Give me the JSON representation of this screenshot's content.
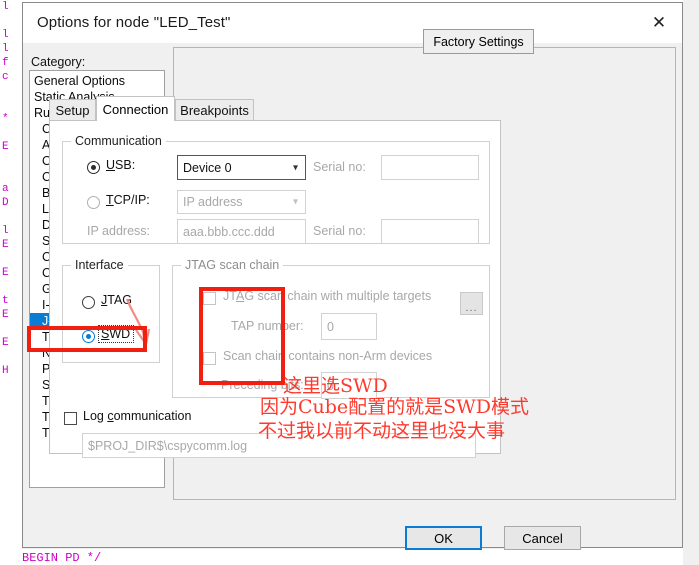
{
  "background": {
    "code_fragments": "l\n \nl\nl\nf\nc\n \n \n*\n \nE\n \n \na\nD\n \nl\nE\n \nE\n \nt\nE\n \nE\n \nH",
    "bottom_code": "BEGIN PD */"
  },
  "dialog": {
    "title": "Options for node \"LED_Test\"",
    "close_icon": "close-icon"
  },
  "category": {
    "label": "Category:",
    "items": [
      {
        "label": "General Options",
        "indent": false,
        "selected": false
      },
      {
        "label": "Static Analysis",
        "indent": false,
        "selected": false
      },
      {
        "label": "Runtime Checking",
        "indent": false,
        "selected": false
      },
      {
        "label": "C/C++ Compiler",
        "indent": true,
        "selected": false
      },
      {
        "label": "Assembler",
        "indent": true,
        "selected": false
      },
      {
        "label": "Output Converter",
        "indent": true,
        "selected": false
      },
      {
        "label": "Custom Build",
        "indent": true,
        "selected": false
      },
      {
        "label": "Build Actions",
        "indent": true,
        "selected": false
      },
      {
        "label": "Linker",
        "indent": true,
        "selected": false
      },
      {
        "label": "Debugger",
        "indent": true,
        "selected": false
      },
      {
        "label": "Simulator",
        "indent": true,
        "selected": false
      },
      {
        "label": "CADI",
        "indent": true,
        "selected": false
      },
      {
        "label": "CMSIS DAP",
        "indent": true,
        "selected": false
      },
      {
        "label": "GDB Server",
        "indent": true,
        "selected": false
      },
      {
        "label": "I-jet/JTAGjet",
        "indent": true,
        "selected": false
      },
      {
        "label": "J-Link/J-Trace",
        "indent": true,
        "selected": true
      },
      {
        "label": "TI Stellaris",
        "indent": true,
        "selected": false
      },
      {
        "label": "Nu-Link",
        "indent": true,
        "selected": false
      },
      {
        "label": "PE micro",
        "indent": true,
        "selected": false
      },
      {
        "label": "ST-LINK",
        "indent": true,
        "selected": false
      },
      {
        "label": "Third-Party Driver",
        "indent": true,
        "selected": false
      },
      {
        "label": "TI MSP-FET",
        "indent": true,
        "selected": false
      },
      {
        "label": "TI XDS",
        "indent": true,
        "selected": false
      }
    ]
  },
  "right_pane": {
    "factory_settings": "Factory Settings",
    "tabs": [
      {
        "label": "Setup",
        "active": false
      },
      {
        "label": "Connection",
        "active": true
      },
      {
        "label": "Breakpoints",
        "active": false
      }
    ]
  },
  "communication": {
    "title": "Communication",
    "usb_label": "USB:",
    "usb_selected": true,
    "usb_device_value": "Device 0",
    "usb_serial_label": "Serial no:",
    "usb_serial_value": "",
    "tcpip_label": "TCP/IP:",
    "tcpip_selected": false,
    "tcpip_value": "IP address",
    "ip_address_label": "IP address:",
    "ip_address_value": "aaa.bbb.ccc.ddd",
    "tcpip_serial_label": "Serial no:",
    "tcpip_serial_value": "",
    "dropdown_icon": "chevron-down-icon"
  },
  "interface": {
    "title": "Interface",
    "jtag_label": "JTAG",
    "jtag_selected": false,
    "swd_label": "SWD",
    "swd_selected": true
  },
  "jtag_scan_chain": {
    "title": "JTAG scan chain",
    "multiple_targets_label": "JTAG scan chain with multiple targets",
    "multiple_targets_checked": false,
    "tap_number_label": "TAP number:",
    "tap_number_value": "0",
    "non_arm_label": "Scan chain contains non-Arm devices",
    "non_arm_checked": false,
    "preceding_bits_label": "Preceding bits:",
    "preceding_bits_value": "0"
  },
  "log": {
    "checkbox_label": "Log communication",
    "checked": false,
    "path_value": "$PROJ_DIR$\\cspycomm.log",
    "browse_label": "...",
    "browse_icon": "ellipsis-icon"
  },
  "footer": {
    "ok_label": "OK",
    "cancel_label": "Cancel"
  },
  "annotations": {
    "line1": "这里选SWD",
    "line2": "因为Cube配置的就是SWD模式",
    "line3": "不过我以前不动这里也没大事",
    "highlight_color": "#f01f10",
    "text_color": "#ff3a2d",
    "arrow_icon": "curved-arrow-icon"
  }
}
